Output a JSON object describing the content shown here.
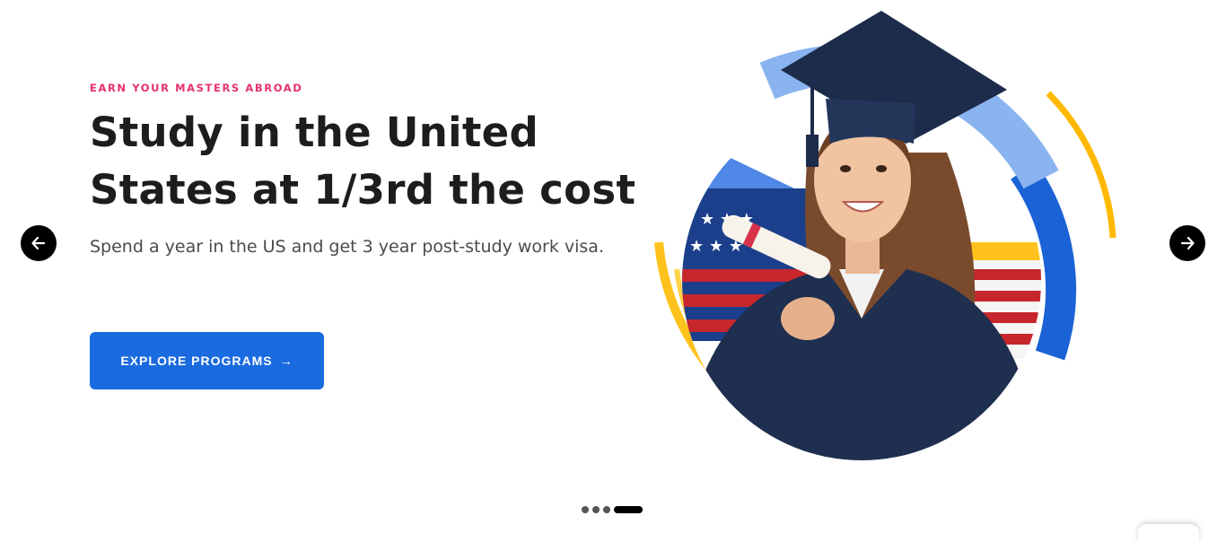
{
  "hero": {
    "eyebrow": "EARN YOUR MASTERS ABROAD",
    "headline_line1": "Study in the United",
    "headline_line2": "States at 1/3rd the cost",
    "subtitle": "Spend a year in the US and get 3 year post-study work visa.",
    "cta_label": "EXPLORE PROGRAMS",
    "cta_arrow": "→"
  },
  "carousel": {
    "slide_count": 4,
    "active_index": 3
  },
  "colors": {
    "eyebrow": "#e6306f",
    "cta_bg": "#1a6ae0",
    "ring_blue": "#1a62d6",
    "ring_light_blue": "#8ab4f0",
    "ring_yellow": "#ffc21c",
    "gown_navy": "#1e2f4f"
  },
  "icons": {
    "prev": "arrow-left-icon",
    "next": "arrow-right-icon"
  }
}
